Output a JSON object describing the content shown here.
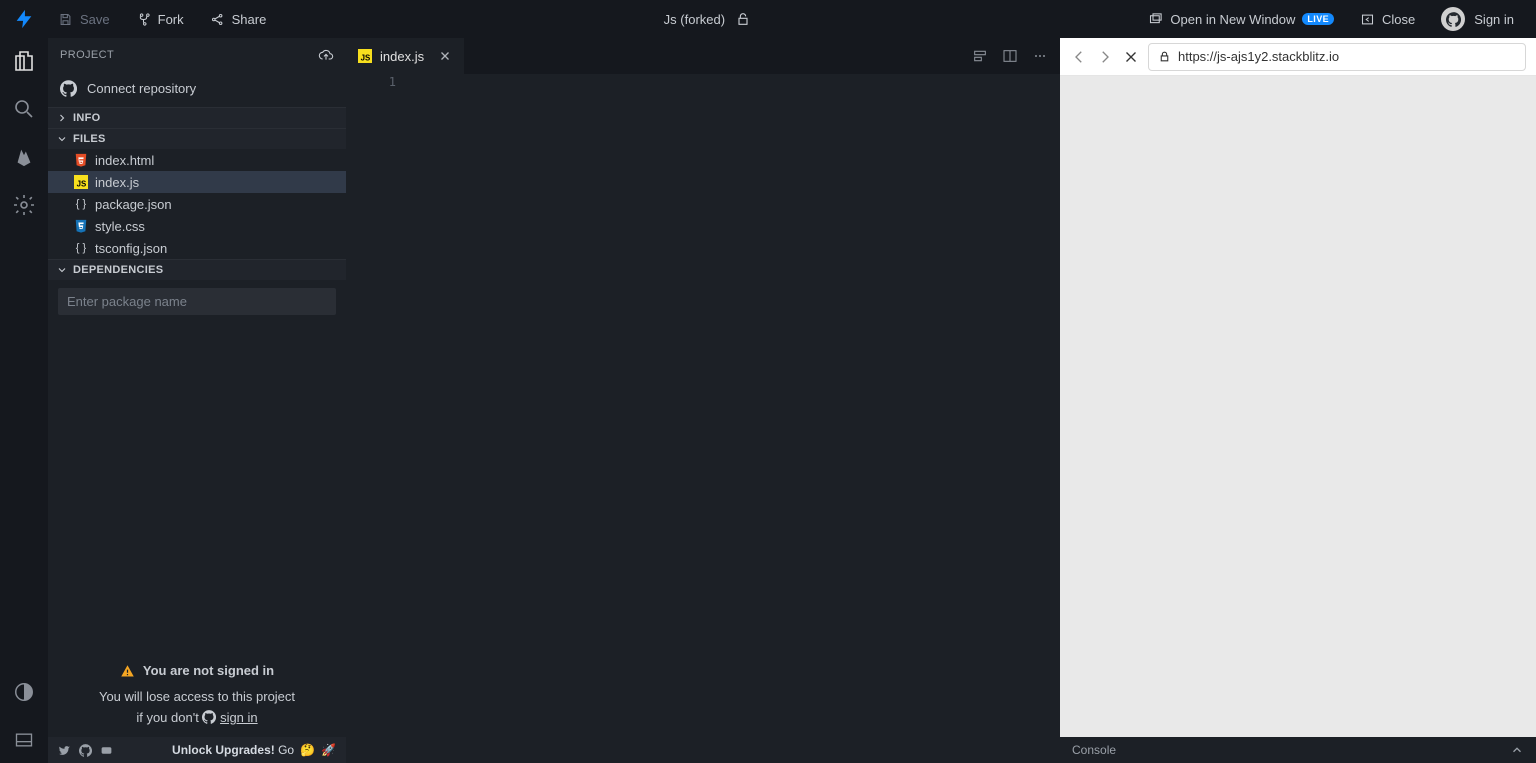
{
  "topbar": {
    "save": "Save",
    "fork": "Fork",
    "share": "Share",
    "title": "Js (forked)",
    "open_new": "Open in New Window",
    "live_badge": "LIVE",
    "close": "Close",
    "signin": "Sign in"
  },
  "sidebar": {
    "header": "PROJECT",
    "connect_repo": "Connect repository",
    "sections": {
      "info": "INFO",
      "files": "FILES",
      "deps": "DEPENDENCIES"
    },
    "files": [
      {
        "name": "index.html",
        "icon": "html"
      },
      {
        "name": "index.js",
        "icon": "js",
        "active": true
      },
      {
        "name": "package.json",
        "icon": "json"
      },
      {
        "name": "style.css",
        "icon": "css"
      },
      {
        "name": "tsconfig.json",
        "icon": "json"
      }
    ],
    "dep_placeholder": "Enter package name",
    "notice_head": "You are not signed in",
    "notice_line1": "You will lose access to this project",
    "notice_line2a": "if you don't ",
    "notice_signin": "sign in",
    "unlock_pre": "Unlock Upgrades!",
    "unlock_go": "Go"
  },
  "editor": {
    "tab_file": "index.js",
    "line1": "1"
  },
  "preview": {
    "url": "https://js-ajs1y2.stackblitz.io",
    "console": "Console"
  }
}
